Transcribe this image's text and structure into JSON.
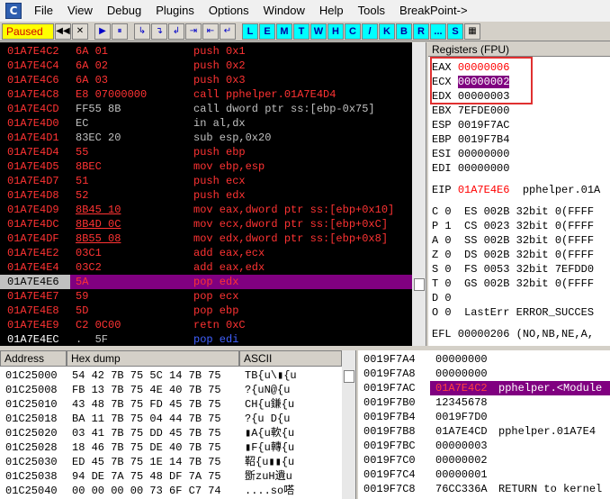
{
  "menu": [
    "File",
    "View",
    "Debug",
    "Plugins",
    "Options",
    "Window",
    "Help",
    "Tools",
    "BreakPoint->"
  ],
  "app_icon_letter": "C",
  "toolbar": {
    "status": "Paused",
    "buttons": [
      "◀◀",
      "✕",
      "▶",
      "⏸",
      "↳",
      "↴",
      "↲",
      "⇥",
      "⇤",
      "↵"
    ],
    "letters": [
      "L",
      "E",
      "M",
      "T",
      "W",
      "H",
      "C",
      "/",
      "K",
      "B",
      "R",
      "...",
      "S"
    ]
  },
  "disasm": [
    {
      "addr": "01A7E4C2",
      "hex": "6A 01",
      "asm": "push 0x1",
      "style": "red"
    },
    {
      "addr": "01A7E4C4",
      "hex": "6A 02",
      "asm": "push 0x2",
      "style": "red"
    },
    {
      "addr": "01A7E4C6",
      "hex": "6A 03",
      "asm": "push 0x3",
      "style": "red"
    },
    {
      "addr": "01A7E4C8",
      "hex": "E8 07000000",
      "asm": "call pphelper.01A7E4D4",
      "style": "red"
    },
    {
      "addr": "01A7E4CD",
      "hex": "FF55 8B",
      "asm": "call dword ptr ss:[ebp-0x75]",
      "style": "grey"
    },
    {
      "addr": "01A7E4D0",
      "hex": "EC",
      "asm": "in al,dx",
      "style": "grey"
    },
    {
      "addr": "01A7E4D1",
      "hex": "83EC 20",
      "asm": "sub esp,0x20",
      "style": "grey"
    },
    {
      "addr": "01A7E4D4",
      "hex": "55",
      "asm": "push ebp",
      "style": "red"
    },
    {
      "addr": "01A7E4D5",
      "hex": "8BEC",
      "asm": "mov ebp,esp",
      "style": "red"
    },
    {
      "addr": "01A7E4D7",
      "hex": "51",
      "asm": "push ecx",
      "style": "red"
    },
    {
      "addr": "01A7E4D8",
      "hex": "52",
      "asm": "push edx",
      "style": "red"
    },
    {
      "addr": "01A7E4D9",
      "hex": "8B45 10",
      "asm": "mov eax,dword ptr ss:[ebp+0x10]",
      "style": "red"
    },
    {
      "addr": "01A7E4DC",
      "hex": "8B4D 0C",
      "asm": "mov ecx,dword ptr ss:[ebp+0xC]",
      "style": "red"
    },
    {
      "addr": "01A7E4DF",
      "hex": "8B55 08",
      "asm": "mov edx,dword ptr ss:[ebp+0x8]",
      "style": "red"
    },
    {
      "addr": "01A7E4E2",
      "hex": "03C1",
      "asm": "add eax,ecx",
      "style": "red"
    },
    {
      "addr": "01A7E4E4",
      "hex": "03C2",
      "asm": "add eax,edx",
      "style": "red"
    },
    {
      "addr": "01A7E4E6",
      "hex": "5A",
      "asm": "pop edx",
      "style": "sel"
    },
    {
      "addr": "01A7E4E7",
      "hex": "59",
      "asm": "pop ecx",
      "style": "red"
    },
    {
      "addr": "01A7E4E8",
      "hex": "5D",
      "asm": "pop ebp",
      "style": "red"
    },
    {
      "addr": "01A7E4E9",
      "hex": "C2 0C00",
      "asm": "retn 0xC",
      "style": "red"
    },
    {
      "addr": "01A7E4EC",
      "hex": ".  5F",
      "asm": "pop edi",
      "style": "last"
    }
  ],
  "registers": {
    "header": "Registers (FPU)",
    "gp": [
      {
        "name": "EAX",
        "val": "00000006",
        "style": "red",
        "extra": ""
      },
      {
        "name": "ECX",
        "val": "00000002",
        "style": "hl",
        "extra": ""
      },
      {
        "name": "EDX",
        "val": "00000003",
        "style": "normal",
        "extra": ""
      },
      {
        "name": "EBX",
        "val": "7EFDE000",
        "style": "normal",
        "extra": ""
      },
      {
        "name": "ESP",
        "val": "0019F7AC",
        "style": "normal",
        "extra": ""
      },
      {
        "name": "EBP",
        "val": "0019F7B4",
        "style": "normal",
        "extra": ""
      },
      {
        "name": "ESI",
        "val": "00000000",
        "style": "normal",
        "extra": ""
      },
      {
        "name": "EDI",
        "val": "00000000",
        "style": "normal",
        "extra": ""
      }
    ],
    "eip": {
      "name": "EIP",
      "val": "01A7E4E6",
      "extra": "pphelper.01A"
    },
    "flags": [
      "C 0  ES 002B 32bit 0(FFFF",
      "P 1  CS 0023 32bit 0(FFFF",
      "A 0  SS 002B 32bit 0(FFFF",
      "Z 0  DS 002B 32bit 0(FFFF",
      "S 0  FS 0053 32bit 7EFDD0",
      "T 0  GS 002B 32bit 0(FFFF",
      "D 0",
      "O 0  LastErr ERROR_SUCCES"
    ],
    "efl": "EFL 00000206 (NO,NB,NE,A,"
  },
  "dump": {
    "headers": [
      "Address",
      "Hex dump",
      "ASCII"
    ],
    "rows": [
      {
        "addr": "01C25000",
        "hex": "54 42 7B 75 5C 14 7B 75",
        "ascii": "TB{u\\▮{u"
      },
      {
        "addr": "01C25008",
        "hex": "FB 13 7B 75 4E 40 7B 75",
        "ascii": "?{uN@{u"
      },
      {
        "addr": "01C25010",
        "hex": "43 48 7B 75 FD 45 7B 75",
        "ascii": "CH{u鎌{u"
      },
      {
        "addr": "01C25018",
        "hex": "BA 11 7B 75 04 44 7B 75",
        "ascii": "?{u D{u"
      },
      {
        "addr": "01C25020",
        "hex": "03 41 7B 75 DD 45 7B 75",
        "ascii": "▮A{u軟{u"
      },
      {
        "addr": "01C25028",
        "hex": "18 46 7B 75 DE 40 7B 75",
        "ascii": "▮F{u轉{u"
      },
      {
        "addr": "01C25030",
        "hex": "ED 45 7B 75 1E 14 7B 75",
        "ascii": "鞀{u▮▮{u"
      },
      {
        "addr": "01C25038",
        "hex": "94 DE 7A 75 48 DF 7A 75",
        "ascii": "斵zuH遺u"
      },
      {
        "addr": "01C25040",
        "hex": "00 00 00 00 73 6F C7 74",
        "ascii": "....so嗒"
      }
    ]
  },
  "stack": [
    {
      "addr": "0019F7A4",
      "val": "00000000",
      "cmt": "",
      "sel": false
    },
    {
      "addr": "0019F7A8",
      "val": "00000000",
      "cmt": "",
      "sel": false
    },
    {
      "addr": "0019F7AC",
      "val": "01A7E4C2",
      "cmt": "pphelper.<Module",
      "sel": true
    },
    {
      "addr": "0019F7B0",
      "val": "12345678",
      "cmt": "",
      "sel": false
    },
    {
      "addr": "0019F7B4",
      "val": "0019F7D0",
      "cmt": "",
      "sel": false
    },
    {
      "addr": "0019F7B8",
      "val": "01A7E4CD",
      "cmt": "pphelper.01A7E4",
      "sel": false
    },
    {
      "addr": "0019F7BC",
      "val": "00000003",
      "cmt": "",
      "sel": false
    },
    {
      "addr": "0019F7C0",
      "val": "00000002",
      "cmt": "",
      "sel": false
    },
    {
      "addr": "0019F7C4",
      "val": "00000001",
      "cmt": "",
      "sel": false
    },
    {
      "addr": "0019F7C8",
      "val": "76CC336A",
      "cmt": "RETURN to kernel",
      "sel": false
    }
  ],
  "colors": {
    "disasm_bg": "#000000",
    "disasm_text": "#ff3333",
    "selection": "#800080",
    "paused_bg": "#ffff00",
    "highlight_box": "#e03030"
  }
}
